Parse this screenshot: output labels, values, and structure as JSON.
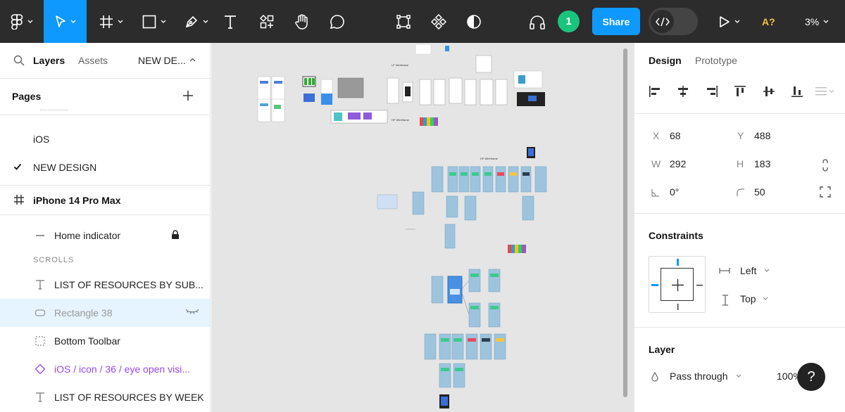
{
  "toolbar": {
    "tools": [
      {
        "name": "main-menu",
        "icon": "figma-logo-icon"
      },
      {
        "name": "move",
        "icon": "cursor-icon",
        "active": true
      },
      {
        "name": "frame",
        "icon": "frame-hash-icon"
      },
      {
        "name": "shape",
        "icon": "rectangle-icon"
      },
      {
        "name": "pen",
        "icon": "pen-icon"
      },
      {
        "name": "text",
        "icon": "text-icon"
      },
      {
        "name": "resources",
        "icon": "components-icon"
      },
      {
        "name": "hand",
        "icon": "hand-icon"
      },
      {
        "name": "comment",
        "icon": "comment-icon"
      }
    ],
    "center_tools": [
      "crop-frame-icon",
      "component-icon",
      "contrast-icon"
    ],
    "avatar_label": "1",
    "share_label": "Share",
    "ai_label": "A?",
    "zoom_label": "3%",
    "accent_color": "#0d99ff",
    "avatar_color": "#1bc47d"
  },
  "left_panel": {
    "tab_layers": "Layers",
    "tab_assets": "Assets",
    "current_page": "NEW DE...",
    "pages_header": "Pages",
    "pages": [
      {
        "label": "iOS",
        "checked": false
      },
      {
        "label": "NEW DESIGN",
        "checked": true
      }
    ],
    "frame_label": "iPhone 14 Pro Max",
    "section_label": "SCROLLS",
    "layers": [
      {
        "label": "Home indicator",
        "icon": "line-icon",
        "locked": true
      },
      {
        "label": "LIST OF RESOURCES BY SUB...",
        "icon": "text-icon"
      },
      {
        "label": "Rectangle 38",
        "icon": "rounded-rect-icon",
        "hidden": true,
        "selected": true
      },
      {
        "label": "Bottom Toolbar",
        "icon": "dashed-frame-icon"
      },
      {
        "label": "iOS / icon / 36 / eye open visi...",
        "icon": "instance-icon",
        "component": true
      },
      {
        "label": "LIST OF RESOURCES BY WEEK",
        "icon": "text-icon"
      }
    ]
  },
  "canvas": {
    "labels": [
      "LF Wireframe",
      "HF Wireframe",
      "HF Wireframe"
    ]
  },
  "right_panel": {
    "tab_design": "Design",
    "tab_prototype": "Prototype",
    "x_label": "X",
    "x_value": "68",
    "y_label": "Y",
    "y_value": "488",
    "w_label": "W",
    "w_value": "292",
    "h_label": "H",
    "h_value": "183",
    "rotation_value": "0°",
    "radius_value": "50",
    "constraints_title": "Constraints",
    "constraint_h": "Left",
    "constraint_v": "Top",
    "layer_title": "Layer",
    "blend_mode": "Pass through",
    "opacity": "100%",
    "help_label": "?"
  }
}
